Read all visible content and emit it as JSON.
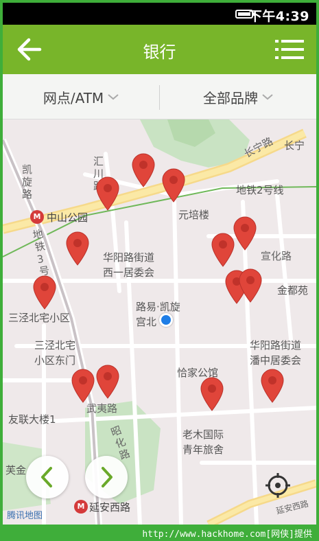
{
  "status": {
    "time": "下午4:39"
  },
  "appbar": {
    "title": "银行"
  },
  "filters": {
    "left": "网点/ATM",
    "right": "全部品牌"
  },
  "map": {
    "labels": {
      "changning_road": "长宁路",
      "changning_short": "长宁",
      "metro2": "地铁2号线",
      "huichuan": "汇川路",
      "kaixuan": "凯旋路",
      "metro3": "地铁3号线",
      "zhongshan_park": "中山公园",
      "yuanpei": "元培楼",
      "huayang_xiyi_1": "华阳路街道",
      "huayang_xiyi_2": "西一居委会",
      "xuanhua": "宣化路",
      "jindu": "金都苑",
      "luyi_1": "路易·凯旋",
      "luyi_2": "宫北",
      "sanjing_xiaoqu": "三泾北宅小区",
      "sanjing_east_1": "三泾北宅",
      "sanjing_east_2": "小区东门",
      "huayang_panzhong_1": "华阳路街道",
      "huayang_panzhong_2": "潘中居委会",
      "qiajia": "恰家公馆",
      "wuyi": "武夷路",
      "youlian": "友联大楼1",
      "zhaohua": "昭化路",
      "laomu_1": "老木国际",
      "laomu_2": "青年旅舍",
      "yanan_west": "延安西路",
      "yanan_road_edge": "延安西路",
      "meijin": "芙金",
      "logo": "腾讯地图"
    }
  },
  "footer": {
    "credit": "http://www.hackhome.com[网侠]提供"
  },
  "colors": {
    "accent": "#78b52a",
    "pin": "#e0453a",
    "location": "#1e7de6"
  }
}
